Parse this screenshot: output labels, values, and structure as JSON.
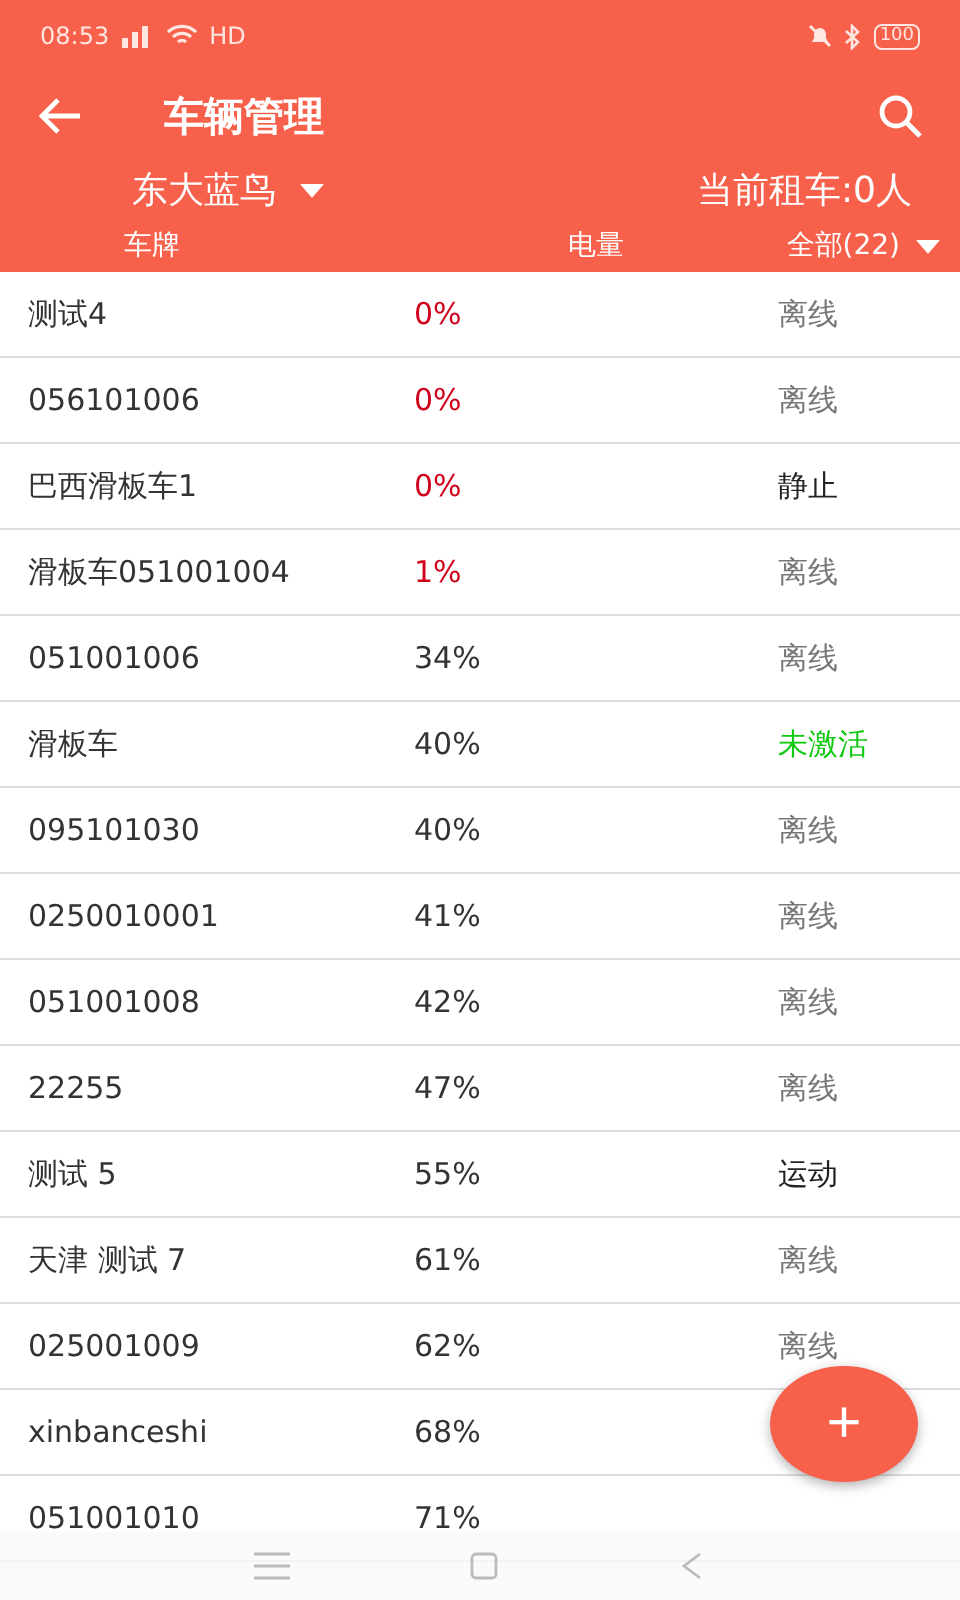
{
  "status_bar": {
    "time": "08:53",
    "network": "HD",
    "battery": "100"
  },
  "toolbar": {
    "title": "车辆管理"
  },
  "filter": {
    "company": "东大蓝鸟",
    "renting": "当前租车:0人"
  },
  "columns": [
    {
      "label": "车牌",
      "kind": "label"
    },
    {
      "label": "电量",
      "kind": "label"
    },
    {
      "label": "全部(22)",
      "kind": "dropdown"
    }
  ],
  "rows": [
    {
      "plate": "测试4",
      "battery": "0%",
      "low": true,
      "status": "离线",
      "kind": "offline"
    },
    {
      "plate": "056101006",
      "battery": "0%",
      "low": true,
      "status": "离线",
      "kind": "offline"
    },
    {
      "plate": "巴西滑板车1",
      "battery": "0%",
      "low": true,
      "status": "静止",
      "kind": "idle"
    },
    {
      "plate": "滑板车051001004",
      "battery": "1%",
      "low": true,
      "status": "离线",
      "kind": "offline"
    },
    {
      "plate": "051001006",
      "battery": "34%",
      "low": false,
      "status": "离线",
      "kind": "offline"
    },
    {
      "plate": "滑板车",
      "battery": "40%",
      "low": false,
      "status": "未激活",
      "kind": "inactive"
    },
    {
      "plate": "095101030",
      "battery": "40%",
      "low": false,
      "status": "离线",
      "kind": "offline"
    },
    {
      "plate": "0250010001",
      "battery": "41%",
      "low": false,
      "status": "离线",
      "kind": "offline"
    },
    {
      "plate": "051001008",
      "battery": "42%",
      "low": false,
      "status": "离线",
      "kind": "offline"
    },
    {
      "plate": "22255",
      "battery": "47%",
      "low": false,
      "status": "离线",
      "kind": "offline"
    },
    {
      "plate": "测试 5",
      "battery": "55%",
      "low": false,
      "status": "运动",
      "kind": "moving"
    },
    {
      "plate": "天津 测试 7",
      "battery": "61%",
      "low": false,
      "status": "离线",
      "kind": "offline"
    },
    {
      "plate": "025001009",
      "battery": "62%",
      "low": false,
      "status": "离线",
      "kind": "offline"
    },
    {
      "plate": "xinbanceshi",
      "battery": "68%",
      "low": false
    },
    {
      "plate": "051001010",
      "battery": "71%",
      "low": false
    }
  ],
  "fab": {
    "label": "+"
  }
}
